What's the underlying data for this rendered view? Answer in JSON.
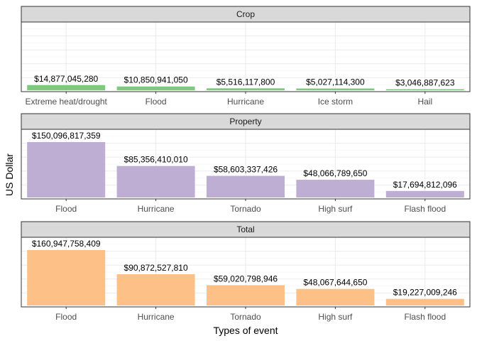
{
  "chart_data": {
    "type": "bar",
    "layout": "faceted-vertical",
    "xlabel": "Types of event",
    "ylabel": "US Dollar",
    "grid": true,
    "colors": {
      "Crop": "#7fc97f",
      "Property": "#beaed4",
      "Total": "#fdc086",
      "strip_bg": "#d9d9d9",
      "grid_major": "#ebebeb",
      "grid_minor": "#f5f5f5",
      "border": "#333333"
    },
    "panels": [
      {
        "name": "Crop",
        "ylim": [
          0,
          160947758409
        ],
        "categories": [
          "Extreme heat/drought",
          "Flood",
          "Hurricane",
          "Ice storm",
          "Hail"
        ],
        "values": [
          14877045280,
          10850941050,
          5516117800,
          5027114300,
          3046887623
        ],
        "labels": [
          "$14,877,045,280",
          "$10,850,941,050",
          "$5,516,117,800",
          "$5,027,114,300",
          "$3,046,887,623"
        ]
      },
      {
        "name": "Property",
        "ylim": [
          0,
          150096817359
        ],
        "categories": [
          "Flood",
          "Hurricane",
          "Tornado",
          "High surf",
          "Flash flood"
        ],
        "values": [
          150096817359,
          85356410010,
          58603337426,
          48066789650,
          17694812096
        ],
        "labels": [
          "$150,096,817,359",
          "$85,356,410,010",
          "$58,603,337,426",
          "$48,066,789,650",
          "$17,694,812,096"
        ]
      },
      {
        "name": "Total",
        "ylim": [
          0,
          160947758409
        ],
        "categories": [
          "Flood",
          "Hurricane",
          "Tornado",
          "High surf",
          "Flash flood"
        ],
        "values": [
          160947758409,
          90872527810,
          59020798946,
          48067644650,
          19227009246
        ],
        "labels": [
          "$160,947,758,409",
          "$90,872,527,810",
          "$59,020,798,946",
          "$48,067,644,650",
          "$19,227,009,246"
        ]
      }
    ]
  }
}
